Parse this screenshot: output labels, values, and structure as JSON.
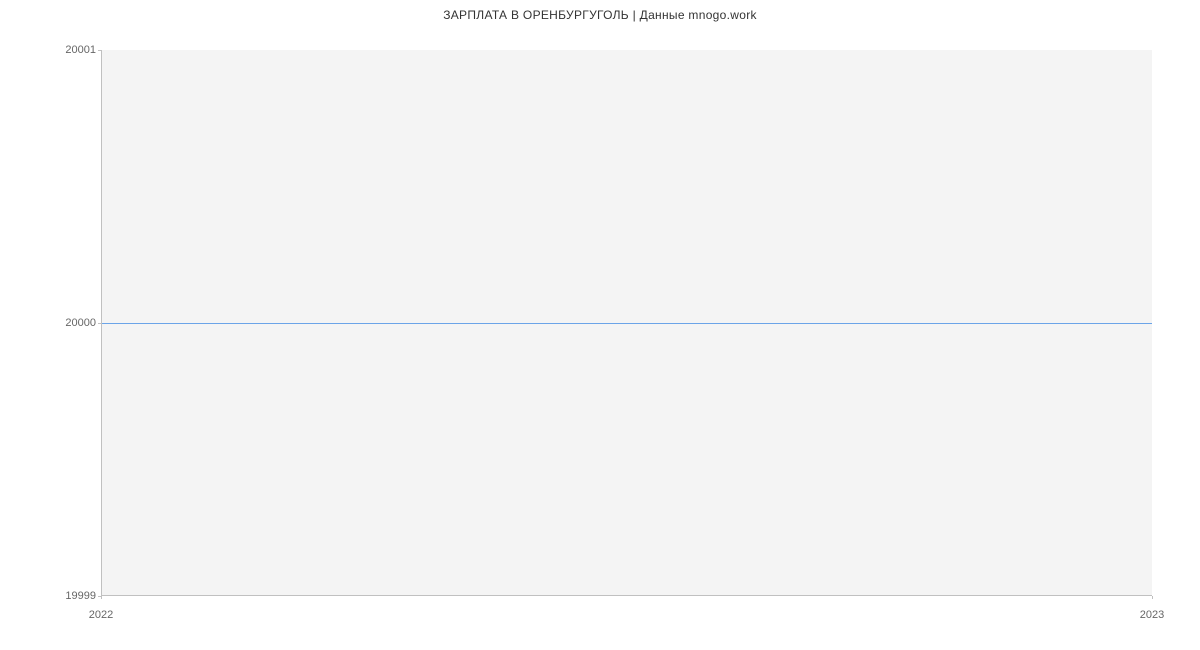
{
  "chart_data": {
    "type": "line",
    "title": "ЗАРПЛАТА В ОРЕНБУРГУГОЛЬ | Данные mnogo.work",
    "x": [
      2022,
      2023
    ],
    "values": [
      20000,
      20000
    ],
    "xlabel": "",
    "ylabel": "",
    "ylim": [
      19999,
      20001
    ],
    "xlim": [
      2022,
      2023
    ],
    "y_ticks": [
      19999,
      20000,
      20001
    ],
    "x_ticks": [
      2022,
      2023
    ],
    "line_color": "#6ba4e8",
    "plot_bg": "#f4f4f4"
  },
  "labels": {
    "y_top": "20001",
    "y_mid": "20000",
    "y_bot": "19999",
    "x_left": "2022",
    "x_right": "2023"
  }
}
